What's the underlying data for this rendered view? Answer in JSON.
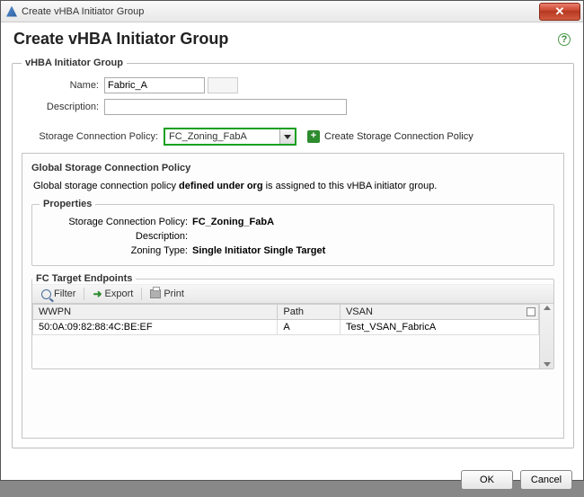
{
  "window": {
    "title": "Create vHBA Initiator Group"
  },
  "page": {
    "heading": "Create vHBA Initiator Group"
  },
  "group_fs": {
    "legend": "vHBA Initiator Group"
  },
  "labels": {
    "name": "Name:",
    "description": "Description:",
    "storage_policy": "Storage Connection Policy:",
    "create_policy_link": "Create Storage Connection Policy"
  },
  "form": {
    "name": "Fabric_A",
    "description": "",
    "policy_selected": "FC_Zoning_FabA"
  },
  "global_fs": {
    "legend": "Global Storage Connection Policy",
    "note_pre": "Global storage connection policy ",
    "note_bold": "defined under org",
    "note_post": " is assigned to this vHBA initiator group."
  },
  "props_fs": {
    "legend": "Properties"
  },
  "props": {
    "policy_label": "Storage Connection Policy:",
    "policy_value": "FC_Zoning_FabA",
    "desc_label": "Description:",
    "desc_value": "",
    "zoning_label": "Zoning Type:",
    "zoning_value": "Single Initiator Single Target"
  },
  "fc_fs": {
    "legend": "FC Target Endpoints"
  },
  "toolbar": {
    "filter": "Filter",
    "export": "Export",
    "print": "Print"
  },
  "table": {
    "headers": {
      "wwpn": "WWPN",
      "path": "Path",
      "vsan": "VSAN"
    },
    "rows": [
      {
        "wwpn": "50:0A:09:82:88:4C:BE:EF",
        "path": "A",
        "vsan": "Test_VSAN_FabricA"
      }
    ]
  },
  "buttons": {
    "ok": "OK",
    "cancel": "Cancel"
  }
}
